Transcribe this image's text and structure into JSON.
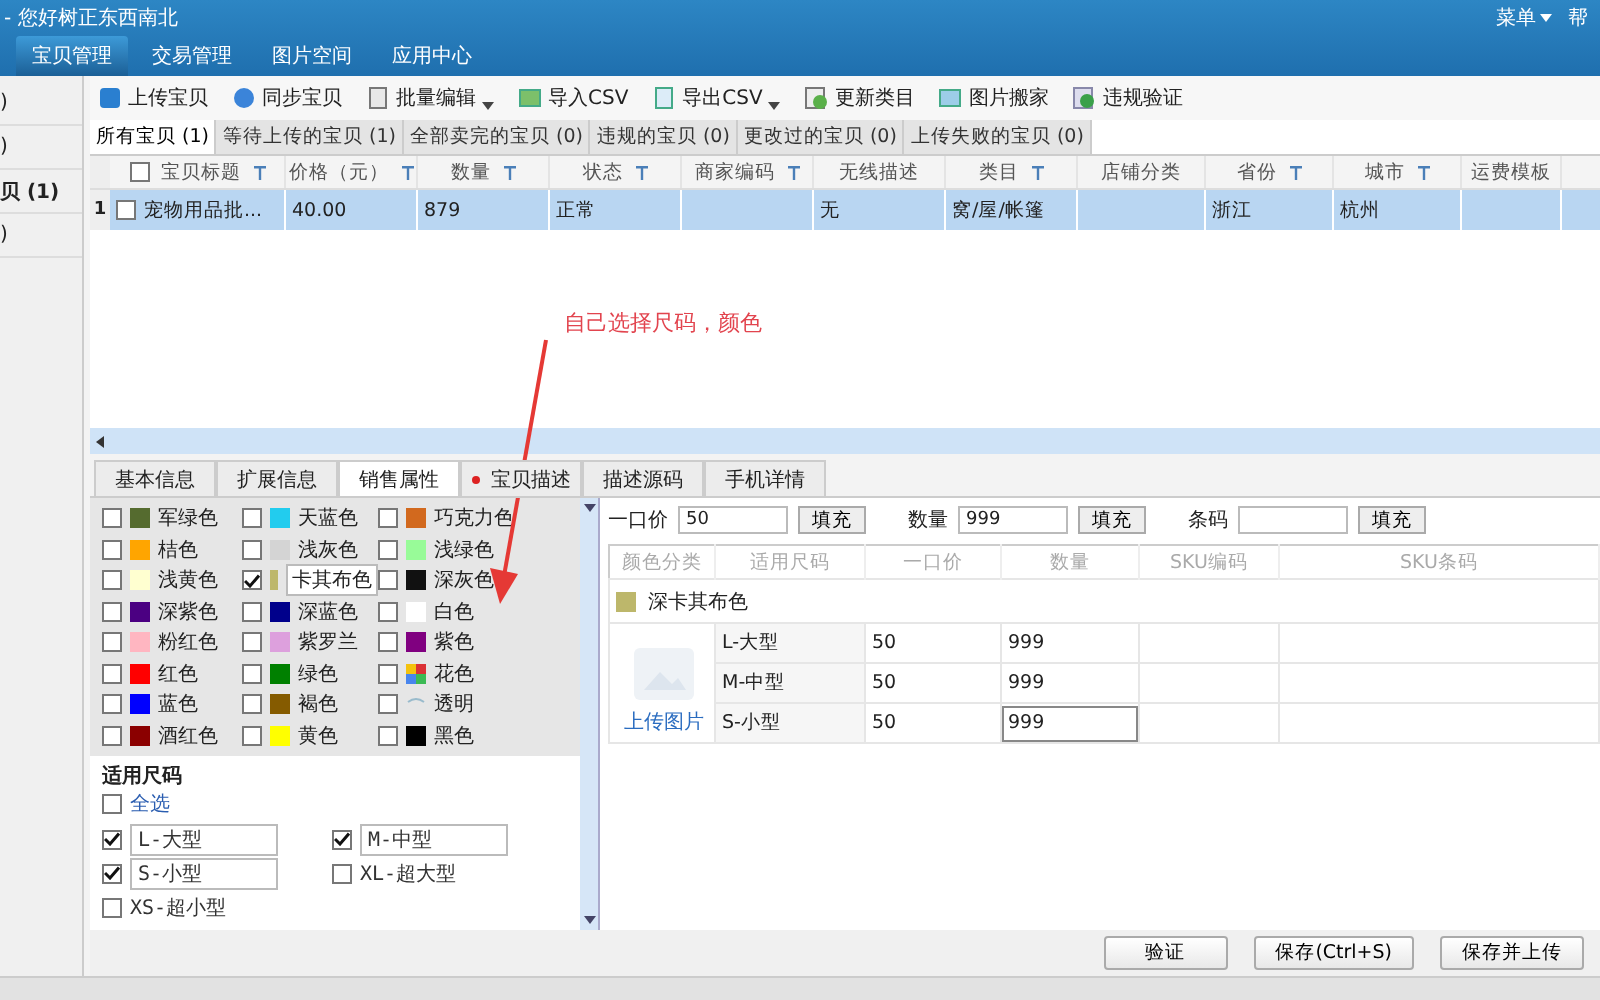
{
  "window": {
    "title": "- 您好树正东西南北",
    "menu": "菜单",
    "help": "帮"
  },
  "nav_tabs": [
    {
      "label": "宝贝管理",
      "selected": true
    },
    {
      "label": "交易管理",
      "selected": false
    },
    {
      "label": "图片空间",
      "selected": false
    },
    {
      "label": "应用中心",
      "selected": false
    }
  ],
  "sidebar": {
    "items": [
      {
        "label": ")",
        "selected": false
      },
      {
        "label": ")",
        "selected": false
      },
      {
        "label": "贝 (1)",
        "selected": true
      },
      {
        "label": ")",
        "selected": false
      }
    ]
  },
  "toolbar": [
    {
      "label": "上传宝贝",
      "dropdown": false
    },
    {
      "label": "同步宝贝",
      "dropdown": false
    },
    {
      "label": "批量编辑",
      "dropdown": true
    },
    {
      "label": "导入CSV",
      "dropdown": false
    },
    {
      "label": "导出CSV",
      "dropdown": true
    },
    {
      "label": "更新类目",
      "dropdown": false
    },
    {
      "label": "图片搬家",
      "dropdown": false
    },
    {
      "label": "违规验证",
      "dropdown": false
    }
  ],
  "filter_tabs": [
    {
      "label": "所有宝贝 (1)",
      "selected": true
    },
    {
      "label": "等待上传的宝贝 (1)",
      "selected": false
    },
    {
      "label": "全部卖完的宝贝 (0)",
      "selected": false
    },
    {
      "label": "违规的宝贝 (0)",
      "selected": false
    },
    {
      "label": "更改过的宝贝 (0)",
      "selected": false
    },
    {
      "label": "上传失败的宝贝 (0)",
      "selected": false
    }
  ],
  "table": {
    "all_checked": false,
    "columns": [
      {
        "label": "宝贝标题",
        "filter": true
      },
      {
        "label": "价格（元）",
        "filter": true
      },
      {
        "label": "数量",
        "filter": true
      },
      {
        "label": "状态",
        "filter": true
      },
      {
        "label": "商家编码",
        "filter": true
      },
      {
        "label": "无线描述",
        "filter": false
      },
      {
        "label": "类目",
        "filter": true
      },
      {
        "label": "店铺分类",
        "filter": false
      },
      {
        "label": "省份",
        "filter": true
      },
      {
        "label": "城市",
        "filter": true
      },
      {
        "label": "运费模板",
        "filter": false
      }
    ],
    "rows": [
      {
        "index": "1",
        "checked": false,
        "selected": true,
        "cells": [
          "宠物用品批...",
          "40.00",
          "879",
          "正常",
          "",
          "无",
          "窝/屋/帐篷",
          "",
          "浙江",
          "杭州",
          ""
        ]
      }
    ]
  },
  "annotation": {
    "text": "自己选择尺码，颜色"
  },
  "detail_tabs": [
    {
      "label": "基本信息",
      "selected": false,
      "required": false
    },
    {
      "label": "扩展信息",
      "selected": false,
      "required": false
    },
    {
      "label": "销售属性",
      "selected": true,
      "required": false
    },
    {
      "label": "宝贝描述",
      "selected": false,
      "required": true
    },
    {
      "label": "描述源码",
      "selected": false,
      "required": false
    },
    {
      "label": "手机详情",
      "selected": false,
      "required": false
    }
  ],
  "colors": [
    {
      "name": "军绿色",
      "kind": "solid",
      "color": "#556b2f",
      "checked": false
    },
    {
      "name": "天蓝色",
      "kind": "solid",
      "color": "#22ccee",
      "checked": false
    },
    {
      "name": "巧克力色",
      "kind": "solid",
      "color": "#d2691e",
      "checked": false
    },
    {
      "name": "桔色",
      "kind": "solid",
      "color": "#ffa500",
      "checked": false
    },
    {
      "name": "浅灰色",
      "kind": "solid",
      "color": "#d4d4d4",
      "checked": false
    },
    {
      "name": "浅绿色",
      "kind": "solid",
      "color": "#98fb98",
      "checked": false
    },
    {
      "name": "浅黄色",
      "kind": "solid",
      "color": "#ffffd0",
      "checked": false
    },
    {
      "name": "卡其布色",
      "kind": "solid",
      "color": "#bdb76b",
      "checked": true
    },
    {
      "name": "深灰色",
      "kind": "solid",
      "color": "#111111",
      "checked": false
    },
    {
      "name": "深紫色",
      "kind": "solid",
      "color": "#4b0082",
      "checked": false
    },
    {
      "name": "深蓝色",
      "kind": "solid",
      "color": "#00008b",
      "checked": false
    },
    {
      "name": "白色",
      "kind": "solid",
      "color": "#ffffff",
      "checked": false
    },
    {
      "name": "粉红色",
      "kind": "solid",
      "color": "#ffb6c1",
      "checked": false
    },
    {
      "name": "紫罗兰",
      "kind": "solid",
      "color": "#dda0dd",
      "checked": false
    },
    {
      "name": "紫色",
      "kind": "solid",
      "color": "#800080",
      "checked": false
    },
    {
      "name": "红色",
      "kind": "solid",
      "color": "#ff0000",
      "checked": false
    },
    {
      "name": "绿色",
      "kind": "solid",
      "color": "#008000",
      "checked": false
    },
    {
      "name": "花色",
      "kind": "multi",
      "checked": false
    },
    {
      "name": "蓝色",
      "kind": "solid",
      "color": "#0000ff",
      "checked": false
    },
    {
      "name": "褐色",
      "kind": "solid",
      "color": "#855b00",
      "checked": false
    },
    {
      "name": "透明",
      "kind": "clear",
      "checked": false
    },
    {
      "name": "酒红色",
      "kind": "solid",
      "color": "#8b0000",
      "checked": false
    },
    {
      "name": "黄色",
      "kind": "solid",
      "color": "#ffff00",
      "checked": false
    },
    {
      "name": "黑色",
      "kind": "solid",
      "color": "#000000",
      "checked": false
    }
  ],
  "sizes": {
    "title": "适用尺码",
    "select_all": {
      "label": "全选",
      "checked": false
    },
    "items": [
      {
        "label": "L-大型",
        "checked": true
      },
      {
        "label": "M-中型",
        "checked": true
      },
      {
        "label": "S-小型",
        "checked": true
      },
      {
        "label": "XL-超大型",
        "checked": false
      },
      {
        "label": "XS-超小型",
        "checked": false
      }
    ]
  },
  "fill_bar": [
    {
      "label": "一口价",
      "value": "50",
      "button": "填充"
    },
    {
      "label": "数量",
      "value": "999",
      "button": "填充"
    },
    {
      "label": "条码",
      "button": "填充"
    }
  ],
  "sku_table": {
    "columns": [
      "颜色分类",
      "适用尺码",
      "一口价",
      "数量",
      "SKU编码",
      "SKU条码"
    ],
    "group": {
      "name": "深卡其布色",
      "color": "#bdb76b"
    },
    "upload_label": "上传图片",
    "rows": [
      {
        "size": "L-大型",
        "price": "50",
        "qty": "999",
        "focused": false
      },
      {
        "size": "M-中型",
        "price": "50",
        "qty": "999",
        "focused": false
      },
      {
        "size": "S-小型",
        "price": "50",
        "qty": "999",
        "focused": true
      }
    ]
  },
  "footer_buttons": [
    "验证",
    "保存(Ctrl+S)",
    "保存并上传"
  ]
}
